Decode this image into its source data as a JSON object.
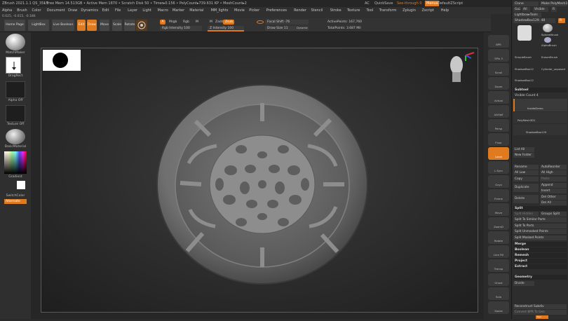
{
  "titlebar": {
    "app": "ZBrush 2021.1.1 QS_3515",
    "mem": "• Free Mem 14.513GB • Active Mem 1870 • Scratch Disk 50 • Timer▸0.156 • PolyCount▸739.631 KP • MeshCount▸2",
    "ac": "AC",
    "quicksave": "QuickSave",
    "seethrough": "See-through  0",
    "menus_btn": "Menus",
    "script": "DefaultZScript"
  },
  "menubar": [
    "Alpha",
    "Brush",
    "Color",
    "Document",
    "Draw",
    "Dynamics",
    "Edit",
    "File",
    "Layer",
    "Light",
    "Macro",
    "Marker",
    "Material",
    "MM_lights",
    "Movie",
    "Picker",
    "Preferences",
    "Render",
    "Stencil",
    "Stroke",
    "Texture",
    "Tool",
    "Transform",
    "Zplugin",
    "Zscript",
    "Help"
  ],
  "statusbar": "0.025, -0.015, -0.186",
  "toolbar": {
    "home": "Home Page",
    "lightbox": "LightBox",
    "livebool": "Live Boolean",
    "edit": "Edit",
    "draw": "Draw",
    "move": "Move",
    "scale": "Scale",
    "rotate": "Rotate",
    "a": "A",
    "mrgb": "Mrgb",
    "rgb": "Rgb",
    "m": "M",
    "rgb_intensity": "Rgb Intensity 100",
    "m2": "M",
    "zadd": "Zadd",
    "zsub": "Zsub",
    "z_intensity": "Z Intensity 100",
    "focal": "Focal Shift -76",
    "drawsize": "Draw Size 11",
    "dynamic": "Dynamic",
    "active_points": "ActivePoints: 167,760",
    "total_points": "TotalPoints: 3.687 Mil"
  },
  "leftpanel": {
    "matcap": "MatchMaker",
    "stroke": "DragRect",
    "alpha": "Alpha Off",
    "texture": "Texture Off",
    "material": "BasicMaterial",
    "gradient": "Gradient",
    "switch": "SwitchColor",
    "alternate": "Alternate"
  },
  "shelf": [
    "BPR",
    "SPix 3",
    "Scroll",
    "Zoom",
    "Actual",
    "AAHalf",
    "Persp",
    "Floor",
    "Local",
    "L.Sym",
    "Gxyz",
    "Frame",
    "Move",
    "ZoomD",
    "Rotate",
    "Line Fill",
    "Transp",
    "Ghost",
    "Solo",
    "Xpose"
  ],
  "tray": {
    "clone": "Clone",
    "make_polymesh": "Make PolyMesh3D",
    "goz": "GoZ",
    "all": "All",
    "visible": "Visible",
    "r": "R",
    "lightbox_tools": "Lightbox▸Tools",
    "shadowbox": "ShadowBox129. 48",
    "r2": "R",
    "sphere": "SphereBrush",
    "alphabrush": "AlphaBrush",
    "simplebrush": "SimpleBrush",
    "eraserbrush": "EraserBrush",
    "shadowbox2": "ShadowBox12",
    "cyl_unposed": "Cylinder_unposed",
    "shadowbox3": "ShadowBox12",
    "subtool": "Subtool",
    "visible_count": "Visible Count 4",
    "st1": "InsideDemo",
    "st2": "PolyMesh3D1",
    "st3": "ShadowBox129",
    "list_all": "List All",
    "new_folder": "New Folder",
    "rename": "Rename",
    "autoreorder": "AutoReorder",
    "all_low": "All Low",
    "all_high": "All High",
    "copy": "Copy",
    "paste": "Paste",
    "duplicate": "Duplicate",
    "append": "Append",
    "insert": "Insert",
    "delete": "Delete",
    "del_other": "Del Other",
    "del_all": "Del All",
    "split": "Split",
    "split_hidden": "Split Hidden",
    "groups_split": "Groups Split",
    "split_similar": "Split To Similar Parts",
    "split_parts": "Split To Parts",
    "split_unmasked": "Split Unmasked Points",
    "split_masked": "Split Masked Points",
    "merge": "Merge",
    "boolean": "Boolean",
    "remesh": "Remesh",
    "project": "Project",
    "extract": "Extract",
    "geometry": "Geometry",
    "divide": "Divide",
    "reconstruct": "Reconstruct Subdiv",
    "convert_bpr": "Convert BPR To Geo",
    "tail": "Dyn"
  },
  "colors": {
    "accent": "#e07a1f",
    "bg": "#2b2b2b"
  }
}
